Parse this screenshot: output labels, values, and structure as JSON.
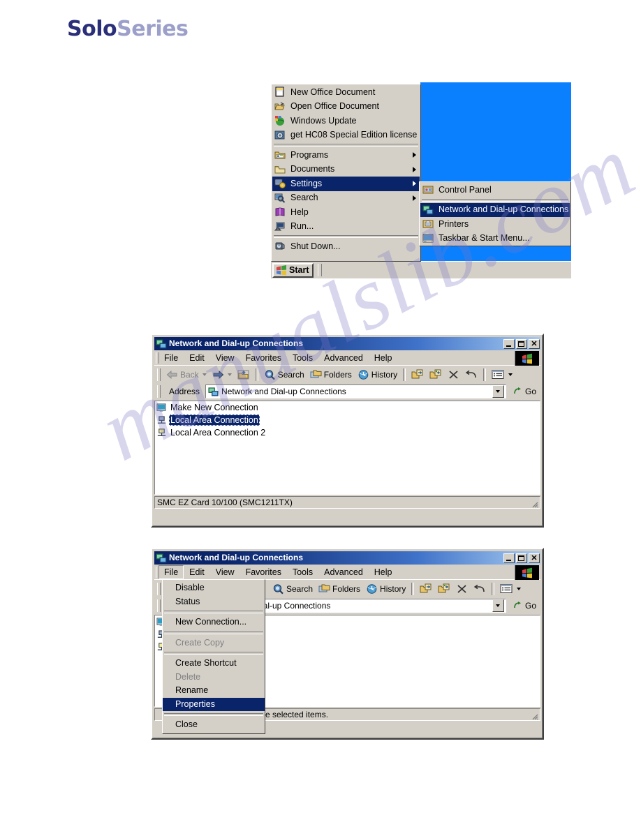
{
  "logo": {
    "part1": "Solo",
    "part2": "Series"
  },
  "watermark": {
    "text": "manualslib.com"
  },
  "start_menu": {
    "items": [
      {
        "label": "New Office Document",
        "icon": "new-office-document-icon",
        "submenu": false
      },
      {
        "label": "Open Office Document",
        "icon": "open-office-document-icon",
        "submenu": false
      },
      {
        "label": "Windows Update",
        "icon": "windows-update-icon",
        "submenu": false
      },
      {
        "label": "get HC08 Special Edition license",
        "icon": "license-icon",
        "submenu": false
      },
      {
        "label": "Programs",
        "icon": "programs-icon",
        "submenu": true
      },
      {
        "label": "Documents",
        "icon": "documents-folder-icon",
        "submenu": true
      },
      {
        "label": "Settings",
        "icon": "settings-icon",
        "submenu": true,
        "highlighted": true
      },
      {
        "label": "Search",
        "icon": "search-icon",
        "submenu": true
      },
      {
        "label": "Help",
        "icon": "help-book-icon",
        "submenu": false
      },
      {
        "label": "Run...",
        "icon": "run-icon",
        "submenu": false
      },
      {
        "label": "Shut Down...",
        "icon": "shutdown-icon",
        "submenu": false
      }
    ],
    "submenu": {
      "items": [
        {
          "label": "Control Panel",
          "icon": "control-panel-icon"
        },
        {
          "label": "Network and Dial-up Connections",
          "icon": "network-connections-icon",
          "highlighted": true
        },
        {
          "label": "Printers",
          "icon": "printers-icon"
        },
        {
          "label": "Taskbar & Start Menu...",
          "icon": "taskbar-icon"
        }
      ]
    },
    "taskbar": {
      "start_label": "Start"
    },
    "desktop_color": "#0a80ff",
    "highlight_color": "#0a246a"
  },
  "window1": {
    "title": "Network and Dial-up Connections",
    "menus": [
      "File",
      "Edit",
      "View",
      "Favorites",
      "Tools",
      "Advanced",
      "Help"
    ],
    "toolbar": {
      "back": "Back",
      "search": "Search",
      "folders": "Folders",
      "history": "History",
      "icons": [
        "move-to-icon",
        "copy-to-icon",
        "delete-icon",
        "undo-icon",
        "views-icon"
      ]
    },
    "address": {
      "label": "Address",
      "value": "Network and Dial-up Connections",
      "go": "Go"
    },
    "list": [
      {
        "label": "Make New Connection",
        "icon": "make-new-connection-icon",
        "selected": false
      },
      {
        "label": "Local Area Connection",
        "icon": "lan-connection-icon",
        "selected": true
      },
      {
        "label": "Local Area Connection 2",
        "icon": "lan-connection-2-icon",
        "selected": false
      }
    ],
    "status": "SMC EZ Card 10/100 (SMC1211TX)"
  },
  "window2": {
    "title": "Network and Dial-up Connections",
    "menus": [
      "File",
      "Edit",
      "View",
      "Favorites",
      "Tools",
      "Advanced",
      "Help"
    ],
    "active_menu": "File",
    "toolbar": {
      "search": "Search",
      "folders": "Folders",
      "history": "History"
    },
    "address": {
      "value": "ial-up Connections",
      "go": "Go"
    },
    "status": "the selected items.",
    "file_menu": {
      "items": [
        {
          "label": "Disable",
          "type": "item"
        },
        {
          "label": "Status",
          "type": "item"
        },
        {
          "type": "separator"
        },
        {
          "label": "New Connection...",
          "type": "item"
        },
        {
          "type": "separator"
        },
        {
          "label": "Create Copy",
          "type": "item",
          "disabled": true
        },
        {
          "type": "separator"
        },
        {
          "label": "Create Shortcut",
          "type": "item"
        },
        {
          "label": "Delete",
          "type": "item",
          "disabled": true
        },
        {
          "label": "Rename",
          "type": "item"
        },
        {
          "label": "Properties",
          "type": "item",
          "highlighted": true
        },
        {
          "type": "separator"
        },
        {
          "label": "Close",
          "type": "item"
        }
      ]
    }
  }
}
